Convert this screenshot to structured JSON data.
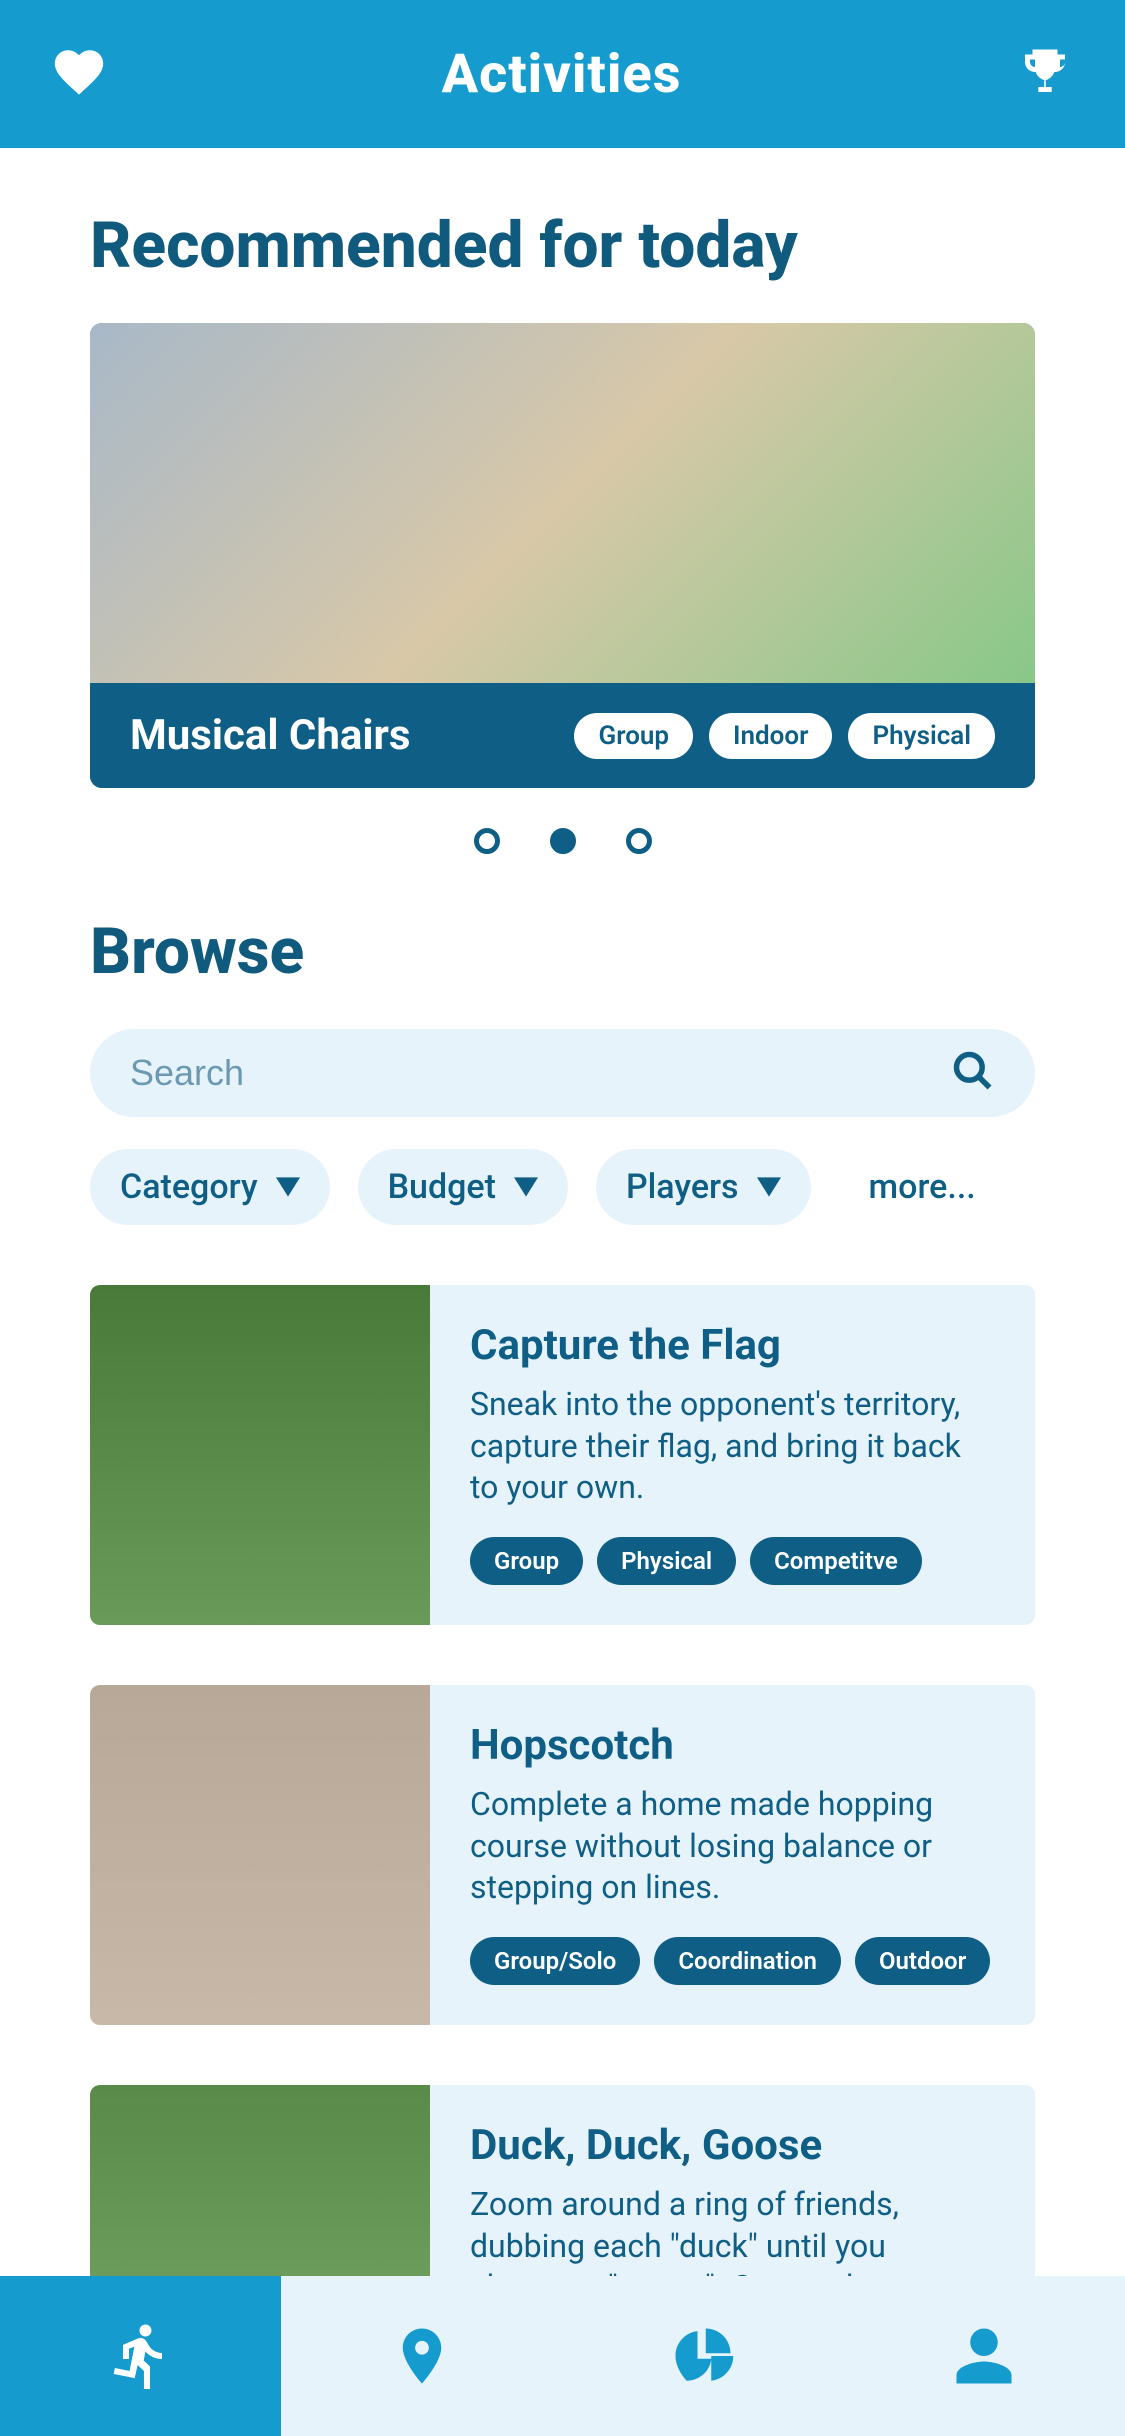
{
  "header": {
    "title": "Activities"
  },
  "recommended": {
    "heading": "Recommended for today",
    "card": {
      "title": "Musical Chairs",
      "tags": [
        "Group",
        "Indoor",
        "Physical"
      ]
    },
    "pager_active_index": 1,
    "pager_count": 3
  },
  "browse": {
    "heading": "Browse",
    "search_placeholder": "Search",
    "filters": [
      "Category",
      "Budget",
      "Players"
    ],
    "more_label": "more...",
    "items": [
      {
        "title": "Capture the Flag",
        "description": "Sneak into the opponent's territory, capture their flag, and bring it back to your own.",
        "tags": [
          "Group",
          "Physical",
          "Competitve"
        ]
      },
      {
        "title": "Hopscotch",
        "description": "Complete a home made hopping course without losing balance or stepping on lines.",
        "tags": [
          "Group/Solo",
          "Coordination",
          "Outdoor"
        ]
      },
      {
        "title": "Duck, Duck, Goose",
        "description": "Zoom around a ring of friends, dubbing each \"duck\" until you choose a \"goose\". Outrun the",
        "tags": []
      }
    ]
  },
  "tabs": {
    "active_index": 0,
    "icons": [
      "running-icon",
      "pin-icon",
      "chart-icon",
      "user-icon"
    ]
  },
  "colors": {
    "primary": "#159bce",
    "dark": "#0e5e85",
    "light": "#e7f3fa"
  }
}
